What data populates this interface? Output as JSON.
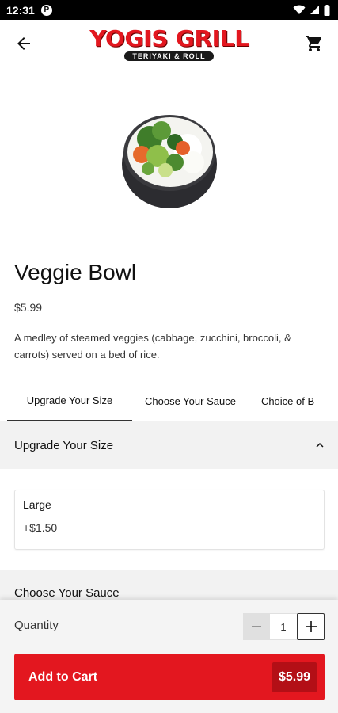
{
  "status_bar": {
    "time": "12:31",
    "app_badge": "P"
  },
  "app_bar": {
    "logo_main": "YOGIS GRILL",
    "logo_sub": "TERIYAKI & ROLL",
    "back_icon": "arrow-back-icon",
    "cart_icon": "shopping-cart-icon"
  },
  "product": {
    "name": "Veggie Bowl",
    "price": "$5.99",
    "description": "A medley of steamed veggies (cabbage, zucchini, broccoli, & carrots) served on a bed of rice."
  },
  "tabs": [
    {
      "label": "Upgrade Your Size",
      "active": true
    },
    {
      "label": "Choose Your Sauce",
      "active": false
    },
    {
      "label": "Choice of B",
      "active": false
    }
  ],
  "sections": {
    "upgrade": {
      "title": "Upgrade Your Size",
      "options": [
        {
          "name": "Large",
          "price": "+$1.50"
        }
      ]
    },
    "sauce": {
      "title": "Choose Your Sauce"
    }
  },
  "order": {
    "quantity_label": "Quantity",
    "quantity": "1",
    "add_label": "Add to Cart",
    "total": "$5.99"
  },
  "colors": {
    "brand_red": "#e3171f",
    "dark_red": "#b30f16",
    "panel_gray": "#f2f2f2"
  }
}
